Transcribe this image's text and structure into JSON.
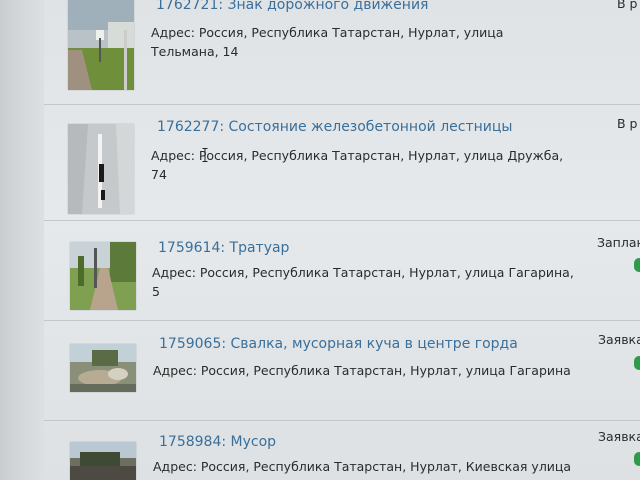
{
  "items": [
    {
      "title": "1762721: Знак дорожного движения",
      "address_line1": "Адрес: Россия, Республика Татарстан, Нурлат, улица",
      "address_line2": "Тельмана, 14",
      "status": "В р"
    },
    {
      "title": "1762277: Состояние железобетонной лестницы",
      "address_line1": "Адрес: Россия, Республика Татарстан, Нурлат, улица Дружба,",
      "address_line2": "74",
      "status": "В р"
    },
    {
      "title": "1759614: Тратуар",
      "address_line1": "Адрес: Россия, Республика Татарстан, Нурлат, улица Гагарина,",
      "address_line2": "5",
      "status": "Заплан"
    },
    {
      "title": "1759065: Свалка, мусорная куча в центре горда",
      "address_line1": "Адрес: Россия, Республика Татарстан, Нурлат, улица Гагарина",
      "address_line2": "",
      "status": "Заявка"
    },
    {
      "title": "1758984: Мусор",
      "address_line1": "Адрес: Россия, Республика Татарстан, Нурлат, Киевская улица",
      "address_line2": "",
      "status": "Заявка"
    }
  ],
  "colors": {
    "link": "#3a6f9a",
    "text": "#2b2b2b",
    "status_dot": "#2f9b4a",
    "background": "#e4e7e9"
  },
  "icons": {
    "status_indicator": "green-dot-icon"
  }
}
